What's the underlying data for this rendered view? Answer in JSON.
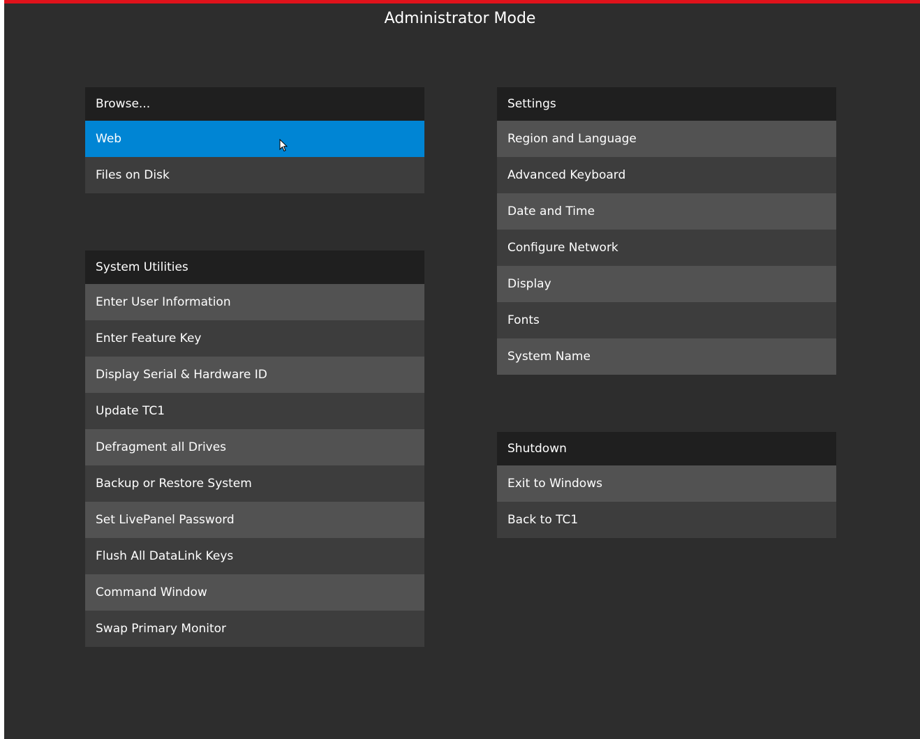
{
  "title": "Administrator Mode",
  "colors": {
    "accent": "#e0121b",
    "selected": "#0085d4",
    "background": "#2d2d2d"
  },
  "browse": {
    "header": "Browse...",
    "items": [
      {
        "label": "Web",
        "selected": true
      },
      {
        "label": "Files on Disk"
      }
    ]
  },
  "system_utilities": {
    "header": "System Utilities",
    "items": [
      {
        "label": "Enter User Information"
      },
      {
        "label": "Enter Feature Key"
      },
      {
        "label": "Display Serial & Hardware ID"
      },
      {
        "label": "Update TC1"
      },
      {
        "label": "Defragment all Drives"
      },
      {
        "label": "Backup or Restore System"
      },
      {
        "label": "Set LivePanel Password"
      },
      {
        "label": "Flush All DataLink Keys"
      },
      {
        "label": "Command Window"
      },
      {
        "label": "Swap Primary Monitor"
      }
    ]
  },
  "settings": {
    "header": "Settings",
    "items": [
      {
        "label": "Region and Language"
      },
      {
        "label": "Advanced Keyboard"
      },
      {
        "label": "Date and Time"
      },
      {
        "label": "Configure Network"
      },
      {
        "label": "Display"
      },
      {
        "label": "Fonts"
      },
      {
        "label": "System Name"
      }
    ]
  },
  "shutdown": {
    "header": "Shutdown",
    "items": [
      {
        "label": "Exit to Windows"
      },
      {
        "label": "Back to TC1"
      }
    ]
  },
  "cursor_icon": "mouse-pointer-icon"
}
